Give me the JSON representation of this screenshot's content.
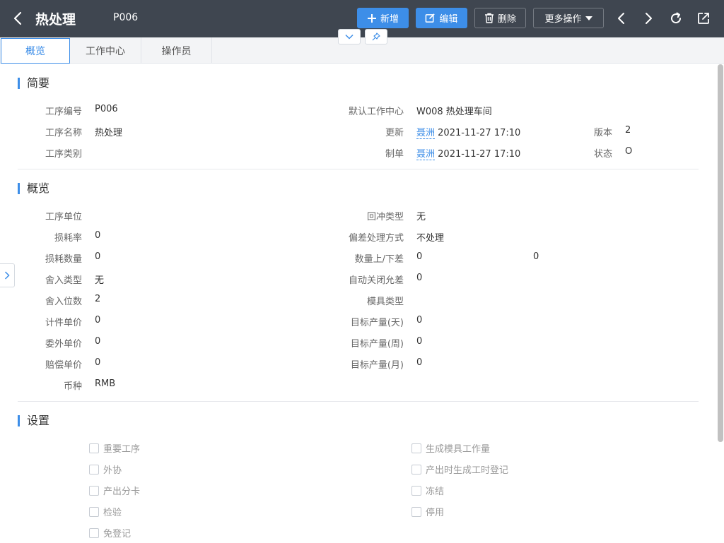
{
  "header": {
    "title": "热处理",
    "code": "P006",
    "buttons": {
      "add": "新增",
      "edit": "编辑",
      "delete": "删除",
      "more": "更多操作"
    }
  },
  "tabs": [
    "概览",
    "工作中心",
    "操作员"
  ],
  "summary": {
    "title": "简要",
    "left": [
      {
        "label": "工序编号",
        "value": "P006"
      },
      {
        "label": "工序名称",
        "value": "热处理"
      },
      {
        "label": "工序类别",
        "value": ""
      }
    ],
    "default_wc_label": "默认工作中心",
    "default_wc_value": "W008 热处理车间",
    "updated_label": "更新",
    "updated_user": "聂洲",
    "updated_time": "2021-11-27 17:10",
    "created_label": "制单",
    "created_user": "聂洲",
    "created_time": "2021-11-27 17:10",
    "version_label": "版本",
    "version_value": "2",
    "status_label": "状态",
    "status_value": "O"
  },
  "overview": {
    "title": "概览",
    "left": [
      {
        "label": "工序单位",
        "value": ""
      },
      {
        "label": "损耗率",
        "value": "0"
      },
      {
        "label": "损耗数量",
        "value": "0"
      },
      {
        "label": "舍入类型",
        "value": "无"
      },
      {
        "label": "舍入位数",
        "value": "2"
      },
      {
        "label": "计件单价",
        "value": "0"
      },
      {
        "label": "委外单价",
        "value": "0"
      },
      {
        "label": "赔偿单价",
        "value": "0"
      },
      {
        "label": "币种",
        "value": "RMB"
      }
    ],
    "right": [
      {
        "label": "回冲类型",
        "value": "无"
      },
      {
        "label": "偏差处理方式",
        "value": "不处理"
      },
      {
        "label": "数量上/下差",
        "value": "0"
      },
      {
        "label": "自动关闭允差",
        "value": "0"
      },
      {
        "label": "模具类型",
        "value": ""
      },
      {
        "label": "目标产量(天)",
        "value": "0"
      },
      {
        "label": "目标产量(周)",
        "value": "0"
      },
      {
        "label": "目标产量(月)",
        "value": "0"
      }
    ],
    "qty_lower_value": "0"
  },
  "settings": {
    "title": "设置",
    "left": [
      "重要工序",
      "外协",
      "产出分卡",
      "检验",
      "免登记"
    ],
    "right": [
      "生成模具工作量",
      "产出时生成工时登记",
      "冻结",
      "停用"
    ]
  }
}
